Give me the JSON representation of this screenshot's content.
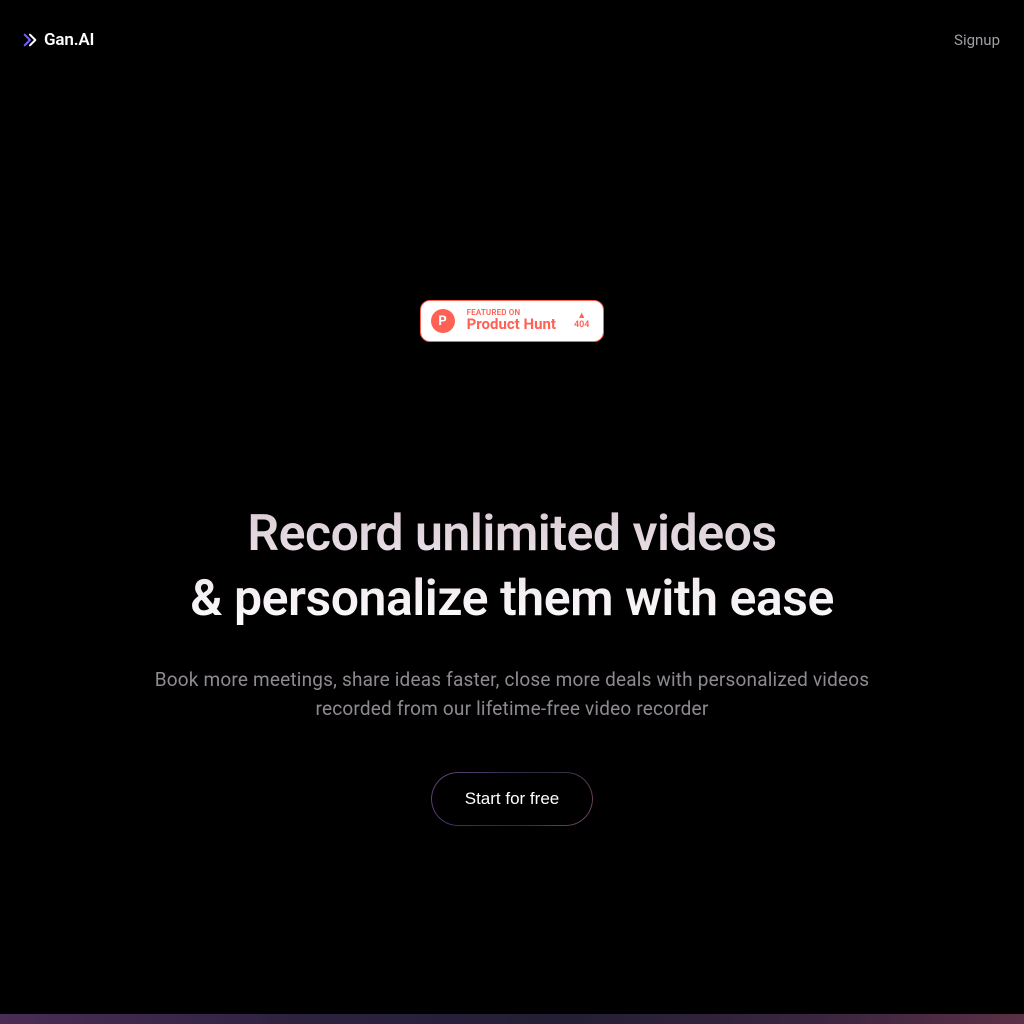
{
  "header": {
    "logo_text": "Gan.AI",
    "signup_label": "Signup"
  },
  "ph_badge": {
    "kicker": "FEATURED ON",
    "name": "Product Hunt",
    "icon_letter": "P",
    "upvote_count": "404"
  },
  "hero": {
    "headline": "Record unlimited videos\n& personalize them with ease",
    "subhead": "Book more meetings, share ideas faster, close more deals with personalized videos recorded from our lifetime-free video recorder",
    "cta_label": "Start for free"
  }
}
